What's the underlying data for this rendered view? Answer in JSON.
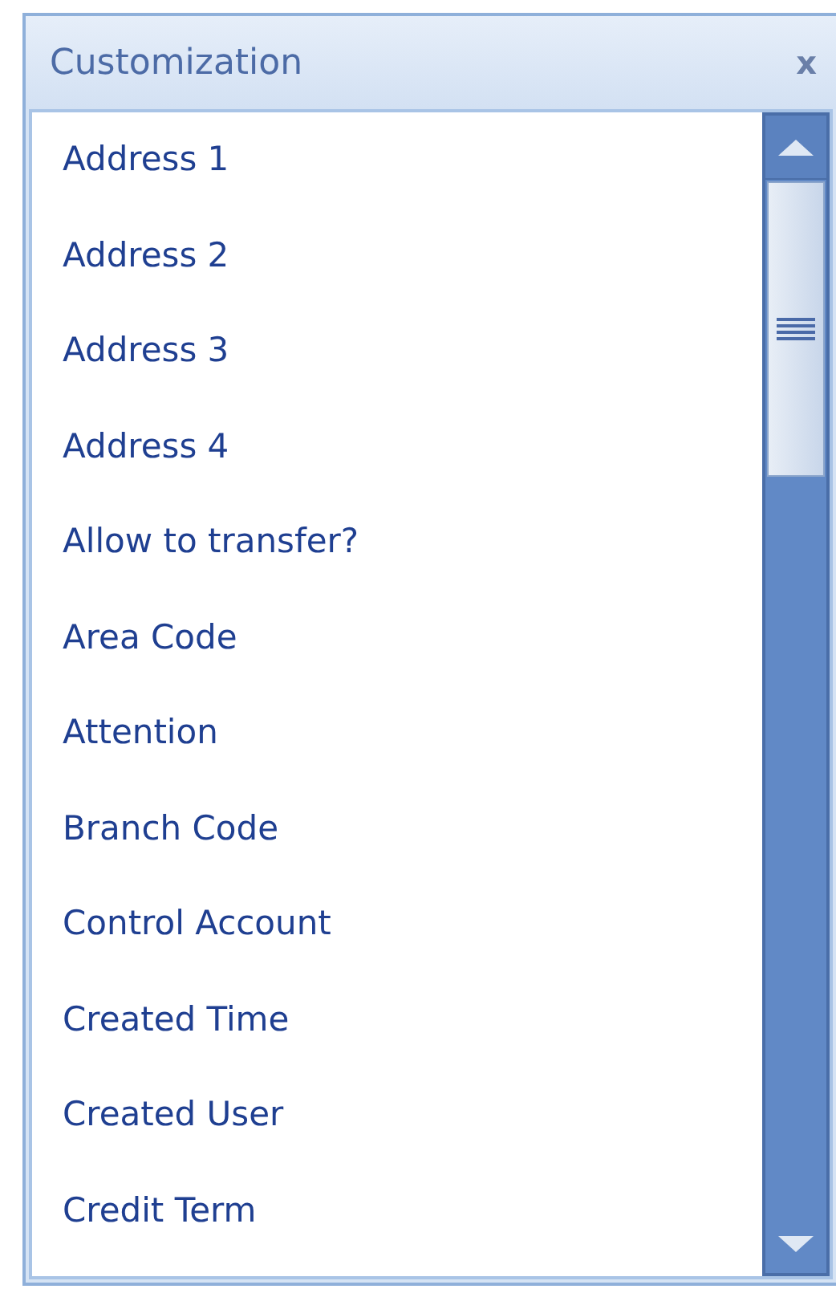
{
  "panel": {
    "title": "Customization",
    "close": "x"
  },
  "items": [
    "Address 1",
    "Address 2",
    "Address 3",
    "Address 4",
    "Allow to transfer?",
    "Area Code",
    "Attention",
    "Branch Code",
    "Control Account",
    "Created Time",
    "Created User",
    "Credit Term"
  ]
}
